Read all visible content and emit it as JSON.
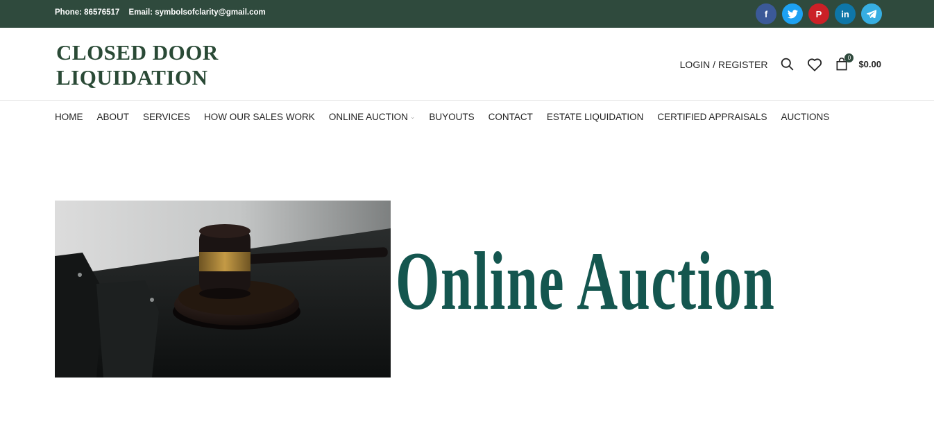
{
  "topbar": {
    "phone": "Phone: 86576517",
    "email": "Email: symbolsofclarity@gmail.com",
    "social": [
      {
        "name": "facebook-icon",
        "glyph": "f",
        "color": "#3b5998"
      },
      {
        "name": "twitter-icon",
        "glyph": "t",
        "color": "#1da1f2"
      },
      {
        "name": "pinterest-icon",
        "glyph": "P",
        "color": "#cb2027"
      },
      {
        "name": "linkedin-icon",
        "glyph": "in",
        "color": "#0e76a8"
      },
      {
        "name": "telegram-icon",
        "glyph": "➤",
        "color": "#37aee2"
      }
    ]
  },
  "header": {
    "logo_line1": "CLOSED DOOR",
    "logo_line2": "LIQUIDATION",
    "login": "LOGIN / REGISTER",
    "cart_count": "0",
    "cart_total": "$0.00"
  },
  "nav": {
    "items": [
      "HOME",
      "ABOUT",
      "SERVICES",
      "HOW OUR SALES WORK",
      "ONLINE AUCTION",
      "BUYOUTS",
      "CONTACT",
      "ESTATE LIQUIDATION",
      "CERTIFIED APPRAISALS",
      "AUCTIONS"
    ]
  },
  "banner": {
    "title": "Online Auction"
  },
  "colors": {
    "topbar_bg": "#2f4a3d",
    "logo": "#2a4a36",
    "banner_title": "#14564f"
  }
}
